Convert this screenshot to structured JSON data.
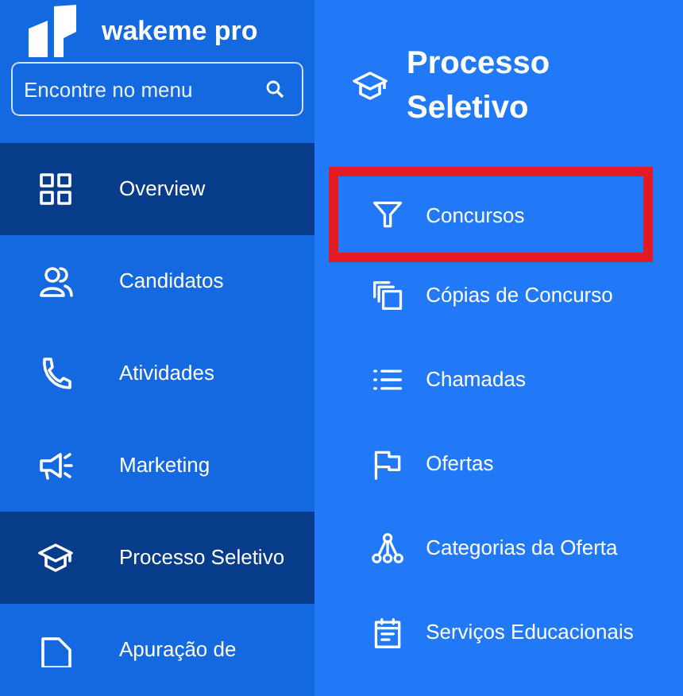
{
  "brand": {
    "name": "wakeme pro"
  },
  "search": {
    "placeholder": "Encontre no menu"
  },
  "sidebar": {
    "items": [
      {
        "label": "Overview",
        "selected": true
      },
      {
        "label": "Candidatos",
        "selected": false
      },
      {
        "label": "Atividades",
        "selected": false
      },
      {
        "label": "Marketing",
        "selected": false
      },
      {
        "label": "Processo Seletivo",
        "selected": true
      },
      {
        "label": "Apuração de",
        "selected": false
      }
    ]
  },
  "submenu": {
    "title": "Processo Seletivo",
    "items": [
      {
        "label": "Concursos",
        "highlighted": true
      },
      {
        "label": "Cópias de Concurso",
        "highlighted": false
      },
      {
        "label": "Chamadas",
        "highlighted": false
      },
      {
        "label": "Ofertas",
        "highlighted": false
      },
      {
        "label": "Categorias da Oferta",
        "highlighted": false
      },
      {
        "label": "Serviços Educacionais",
        "highlighted": false
      }
    ]
  }
}
